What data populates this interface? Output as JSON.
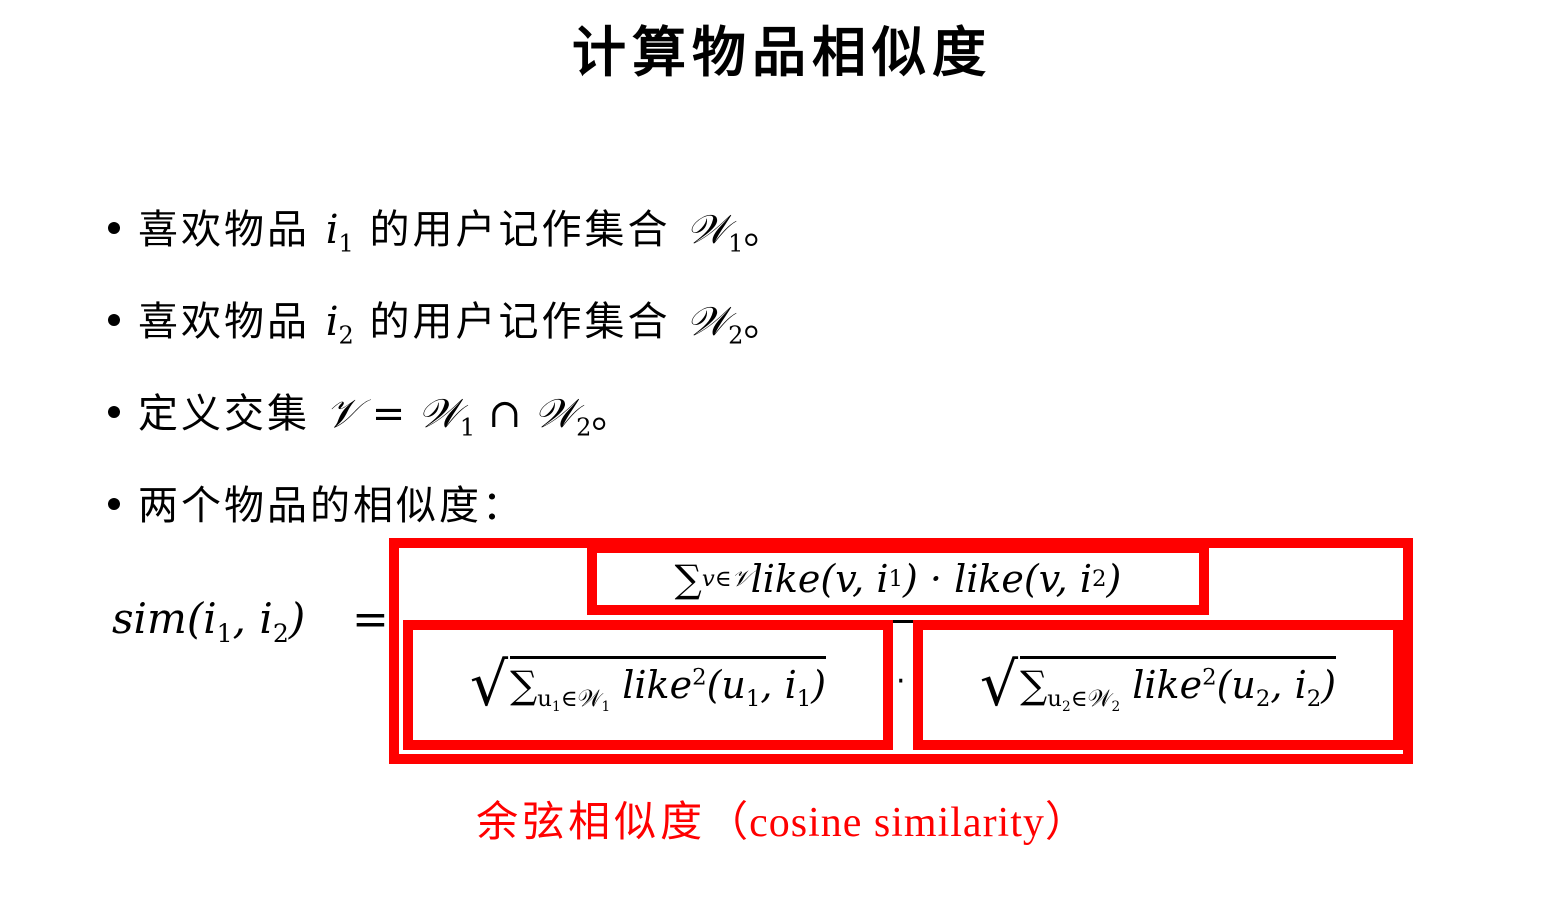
{
  "title": "计算物品相似度",
  "bullets": {
    "b1": {
      "prefix": "喜欢物品",
      "var": "i",
      "sub": "1",
      "middle": "的用户记作集合",
      "set": "𝒲",
      "set_sub": "1",
      "suffix": "。"
    },
    "b2": {
      "prefix": "喜欢物品",
      "var": "i",
      "sub": "2",
      "middle": "的用户记作集合",
      "set": "𝒲",
      "set_sub": "2",
      "suffix": "。"
    },
    "b3": {
      "prefix": "定义交集",
      "expr": "𝒱 = 𝒲",
      "s1": "1",
      "cap": " ∩ 𝒲",
      "s2": "2",
      "suffix": "。"
    },
    "b4": {
      "text": "两个物品的相似度："
    }
  },
  "formula": {
    "lhs": "sim(i",
    "lhs_s1": "1",
    "lhs_mid": ", i",
    "lhs_s2": "2",
    "lhs_end": ")",
    "equals": "=",
    "numerator": {
      "sum": "∑",
      "index": "v∈𝒱",
      "t1": " like(v, i",
      "t1s": "1",
      "t2": ") · like(v, i",
      "t2s": "2",
      "t3": ")"
    },
    "den1": {
      "sum": "∑",
      "idx_a": "u",
      "idx_a_s": "1",
      "idx_b": "∈𝒲",
      "idx_b_s": "1",
      "body": " like",
      "pow": "2",
      "args": "(u",
      "args_s1": "1",
      "args_mid": ", i",
      "args_s2": "1",
      "args_end": ")"
    },
    "den2": {
      "sum": "∑",
      "idx_a": "u",
      "idx_a_s": "2",
      "idx_b": "∈𝒲",
      "idx_b_s": "2",
      "body": " like",
      "pow": "2",
      "args": "(u",
      "args_s1": "2",
      "args_mid": ", i",
      "args_s2": "2",
      "args_end": ")"
    },
    "dot": "·"
  },
  "caption": {
    "cn": "余弦相似度",
    "en": "（cosine similarity）"
  },
  "colors": {
    "highlight": "#ff0000",
    "text": "#000000"
  }
}
